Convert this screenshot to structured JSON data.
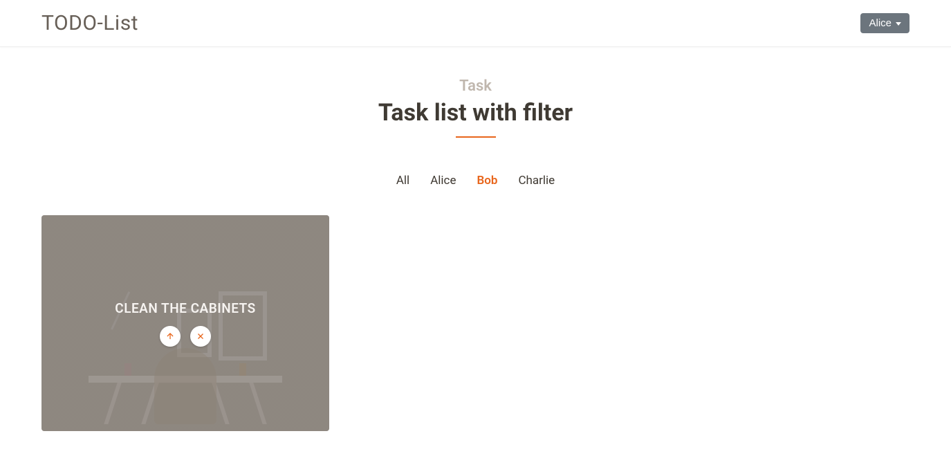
{
  "navbar": {
    "brand": "TODO-List",
    "user_label": "Alice"
  },
  "header": {
    "subtitle": "Task",
    "title": "Task list with filter"
  },
  "filters": [
    {
      "label": "All",
      "active": false
    },
    {
      "label": "Alice",
      "active": false
    },
    {
      "label": "Bob",
      "active": true
    },
    {
      "label": "Charlie",
      "active": false
    }
  ],
  "cards": [
    {
      "title": "CLEAN THE CABINETS"
    }
  ],
  "colors": {
    "accent": "#e8651b"
  }
}
